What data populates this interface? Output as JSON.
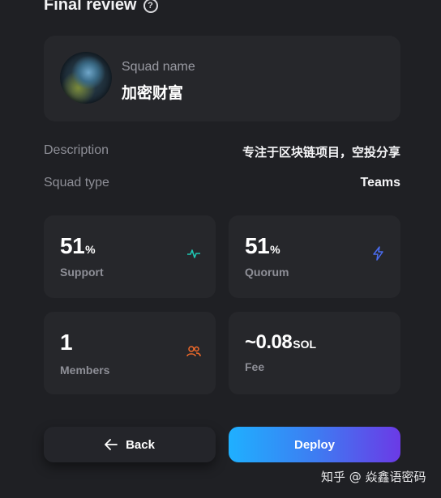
{
  "header": {
    "title": "Final review"
  },
  "squad": {
    "name_label": "Squad name",
    "name_value": "加密财富"
  },
  "details": {
    "description_label": "Description",
    "description_value": "专注于区块链项目，空投分享",
    "type_label": "Squad type",
    "type_value": "Teams"
  },
  "stats": {
    "support": {
      "value": "51",
      "unit": "%",
      "label": "Support",
      "icon": "pulse-icon",
      "icon_color": "#1fc8b4"
    },
    "quorum": {
      "value": "51",
      "unit": "%",
      "label": "Quorum",
      "icon": "lightning-icon",
      "icon_color": "#4a6cf0"
    },
    "members": {
      "value": "1",
      "unit": "",
      "label": "Members",
      "icon": "users-icon",
      "icon_color": "#f06a2a"
    },
    "fee": {
      "value": "~0.08",
      "unit": "SOL",
      "label": "Fee"
    }
  },
  "actions": {
    "back_label": "Back",
    "deploy_label": "Deploy"
  },
  "watermark": {
    "text": "知乎 @ 焱鑫语密码"
  },
  "colors": {
    "accent_start": "#1fb0ff",
    "accent_end": "#6b3ae6",
    "background": "#1f2024",
    "card": "#26272b"
  }
}
